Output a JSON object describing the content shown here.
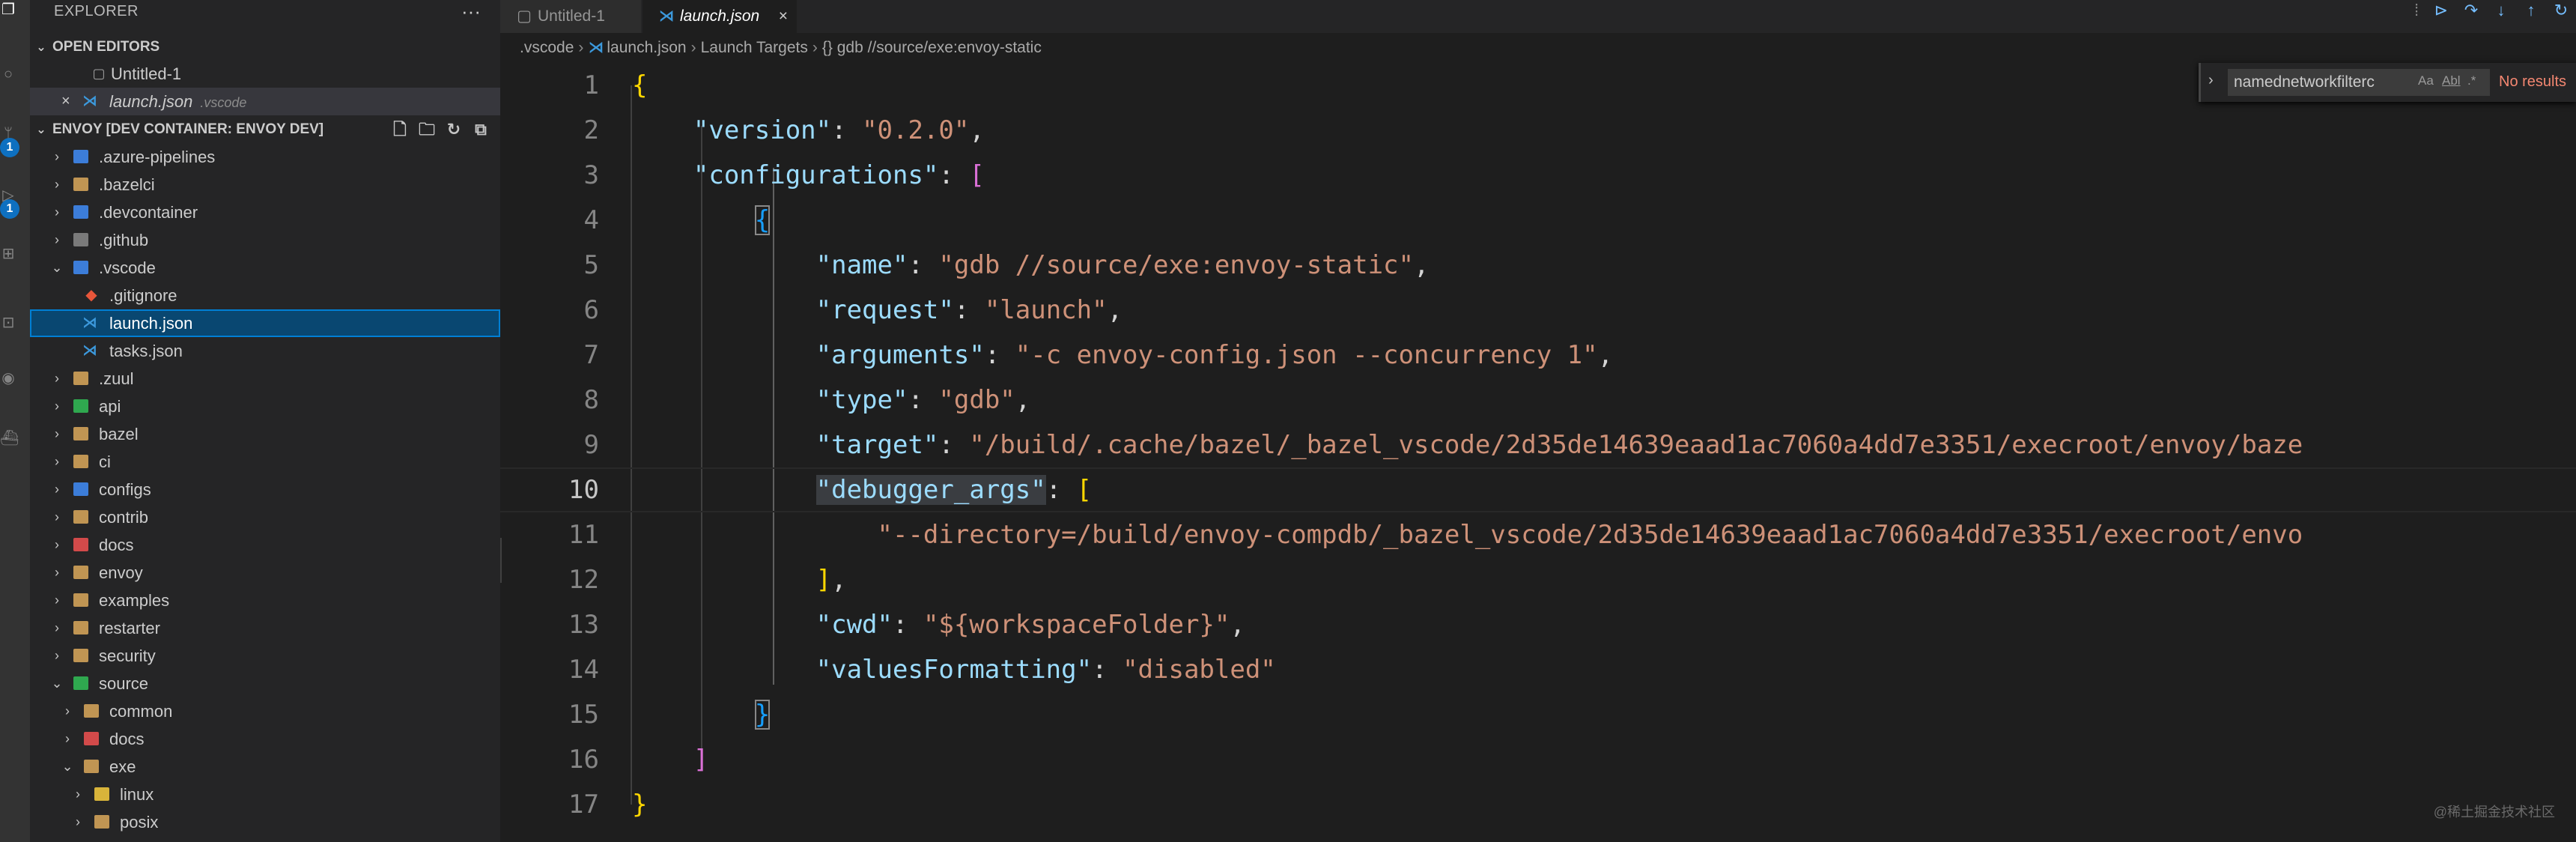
{
  "activity_bar": {
    "icons": [
      "files-icon",
      "search-icon",
      "source-control-icon",
      "run-debug-icon",
      "extensions-icon",
      "remote-explorer-icon",
      "github-icon",
      "docker-icon"
    ],
    "badges": [
      "1",
      "1"
    ]
  },
  "sidebar": {
    "title": "EXPLORER",
    "more": "···",
    "open_editors": {
      "header": "OPEN EDITORS",
      "items": [
        {
          "label": "Untitled-1",
          "description": ""
        },
        {
          "label": "launch.json",
          "description": ".vscode"
        }
      ]
    },
    "workspace": {
      "header": "ENVOY [DEV CONTAINER: ENVOY DEV]",
      "items": [
        {
          "label": ".azure-pipelines"
        },
        {
          "label": ".bazelci"
        },
        {
          "label": ".devcontainer"
        },
        {
          "label": ".github"
        },
        {
          "label": ".vscode"
        },
        {
          "label": ".gitignore"
        },
        {
          "label": "launch.json"
        },
        {
          "label": "tasks.json"
        },
        {
          "label": ".zuul"
        },
        {
          "label": "api"
        },
        {
          "label": "bazel"
        },
        {
          "label": "ci"
        },
        {
          "label": "configs"
        },
        {
          "label": "contrib"
        },
        {
          "label": "docs"
        },
        {
          "label": "envoy"
        },
        {
          "label": "examples"
        },
        {
          "label": "restarter"
        },
        {
          "label": "security"
        },
        {
          "label": "source"
        },
        {
          "label": "common"
        },
        {
          "label": "docs"
        },
        {
          "label": "exe"
        },
        {
          "label": "linux"
        },
        {
          "label": "posix"
        }
      ]
    }
  },
  "tabs": [
    {
      "label": "Untitled-1",
      "active": false
    },
    {
      "label": "launch.json",
      "active": true,
      "close": "×"
    }
  ],
  "breadcrumb": [
    ".vscode",
    "launch.json",
    "Launch Targets",
    "{} gdb //source/exe:envoy-static"
  ],
  "find_widget": {
    "query": "namednetworkfilterc",
    "options": [
      "Aa",
      "Abl",
      ".*"
    ],
    "result": "No results"
  },
  "editor": {
    "current_line": 10,
    "lines": [
      {
        "n": "1"
      },
      {
        "n": "2"
      },
      {
        "n": "3"
      },
      {
        "n": "4"
      },
      {
        "n": "5"
      },
      {
        "n": "6"
      },
      {
        "n": "7"
      },
      {
        "n": "8"
      },
      {
        "n": "9"
      },
      {
        "n": "10"
      },
      {
        "n": "11"
      },
      {
        "n": "12"
      },
      {
        "n": "13"
      },
      {
        "n": "14"
      },
      {
        "n": "15"
      },
      {
        "n": "16"
      },
      {
        "n": "17"
      }
    ],
    "tokens": {
      "l1_open": "{",
      "l2_key": "\"version\"",
      "l2_val": "\"0.2.0\"",
      "l3_key": "\"configurations\"",
      "l3_open": "[",
      "l4_open": "{",
      "l5_key": "\"name\"",
      "l5_val": "\"gdb //source/exe:envoy-static\"",
      "l6_key": "\"request\"",
      "l6_val": "\"launch\"",
      "l7_key": "\"arguments\"",
      "l7_val": "\"-c envoy-config.json --concurrency 1\"",
      "l8_key": "\"type\"",
      "l8_val": "\"gdb\"",
      "l9_key": "\"target\"",
      "l9_val": "\"/build/.cache/bazel/_bazel_vscode/2d35de14639eaad1ac7060a4dd7e3351/execroot/envoy/baze",
      "l10_key": "\"debugger_args\"",
      "l10_open": "[",
      "l11_val": "\"--directory=/build/envoy-compdb/_bazel_vscode/2d35de14639eaad1ac7060a4dd7e3351/execroot/envo",
      "l12_close": "]",
      "l13_key": "\"cwd\"",
      "l13_val": "\"${workspaceFolder}\"",
      "l14_key": "\"valuesFormatting\"",
      "l14_val": "\"disabled\"",
      "l15_close": "}",
      "l16_close": "]",
      "l17_close": "}"
    }
  },
  "watermark": "@稀土掘金技术社区",
  "colors": {
    "key": "#9cdcfe",
    "string": "#ce9178",
    "bracket1": "#ffd700",
    "bracket2": "#da70d6",
    "bracket3": "#179fff",
    "selection": "#094771",
    "badge": "#0e70c0"
  }
}
